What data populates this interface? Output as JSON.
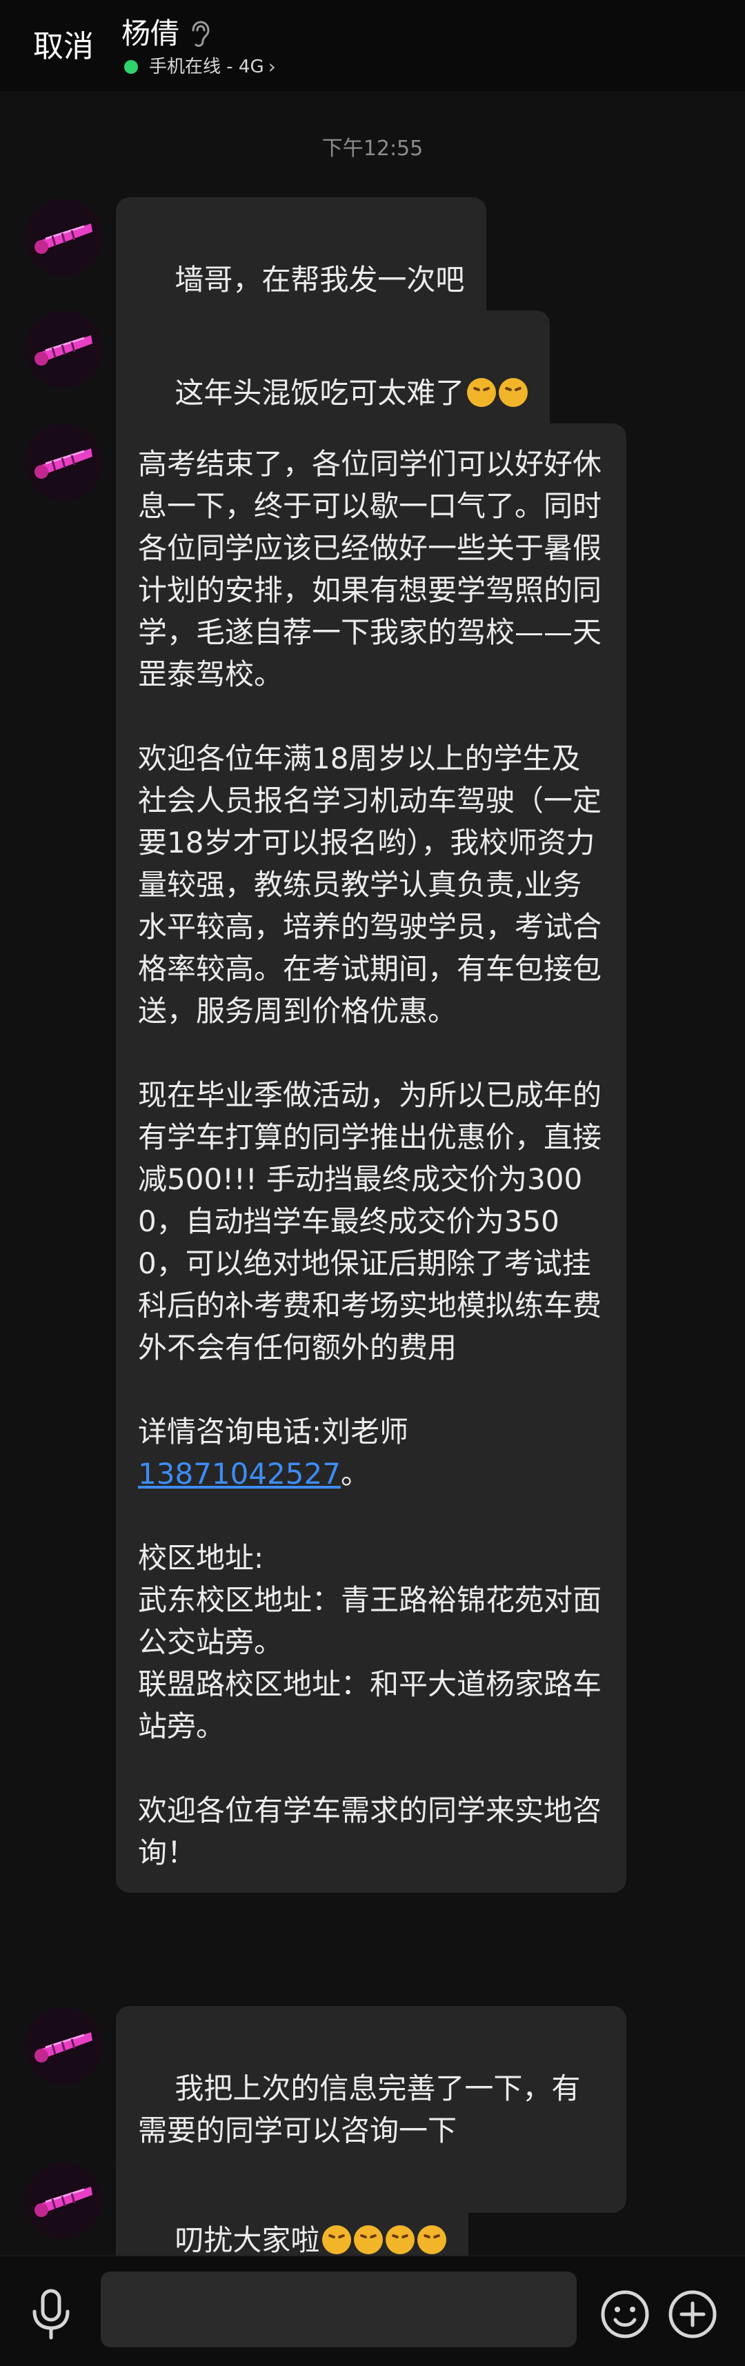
{
  "header": {
    "cancel_label": "取消",
    "contact_name": "杨倩",
    "status_text": "手机在线 - 4G",
    "status_color": "#2fd36b"
  },
  "chat": {
    "timestamp": "下午12:55",
    "messages": [
      {
        "text": "墙哥，在帮我发一次吧"
      },
      {
        "text": "这年头混饭吃可太难了",
        "emoji_count": 2
      },
      {
        "text": "高考结束了，各位同学们可以好好休息一下，终于可以歇一口气了。同时各位同学应该已经做好一些关于暑假计划的安排，如果有想要学驾照的同学，毛遂自荐一下我家的驾校——天罡泰驾校。\n\n欢迎各位年满18周岁以上的学生及社会人员报名学习机动车驾驶（一定要18岁才可以报名哟），我校师资力量较强，教练员教学认真负责,业务水平较高，培养的驾驶学员，考试合格率较高。在考试期间，有车包接包送，服务周到价格优惠。\n\n现在毕业季做活动，为所以已成年的有学车打算的同学推出优惠价，直接减500!!! 手动挡最终成交价为3000，自动挡学车最终成交价为3500，可以绝对地保证后期除了考试挂科后的补考费和考场实地模拟练车费外不会有任何额外的费用\n\n详情咨询电话:刘老师",
        "phone": "13871042527",
        "phone_suffix": "。",
        "text_after": "\n\n校区地址:\n武东校区地址：青王路裕锦花苑对面公交站旁。\n联盟路校区地址：和平大道杨家路车站旁。\n\n欢迎各位有学车需求的同学来实地咨询！"
      },
      {
        "text": "我把上次的信息完善了一下，有需要的同学可以咨询一下"
      },
      {
        "text": "叨扰大家啦",
        "emoji_count": 4
      }
    ],
    "link_color": "#3d8df5"
  },
  "input_bar": {
    "icons": [
      "microphone-icon",
      "emoji-icon",
      "plus-icon"
    ]
  }
}
